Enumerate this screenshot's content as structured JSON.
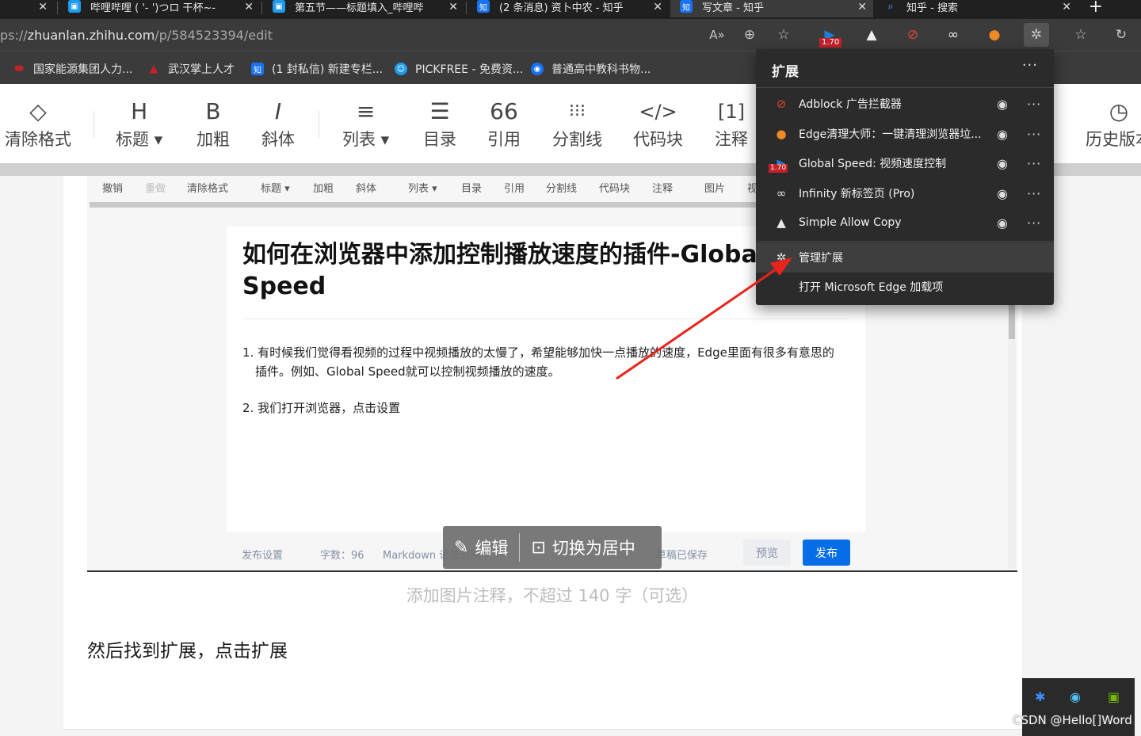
{
  "tabs": [
    {
      "title": "哔哩哔哩 ( '- ')つロ 干杯~-",
      "active": false
    },
    {
      "title": "第五节——标题填入_哔哩哔",
      "active": false
    },
    {
      "title": "(2 条消息) 资卜中农 - 知乎",
      "active": false
    },
    {
      "title": "写文章 - 知乎",
      "active": true
    },
    {
      "title": "知乎 - 搜索",
      "active": false
    }
  ],
  "address": {
    "scheme_part": "ps://",
    "host": "zhuanlan.zhihu.com",
    "path": "/p/584523394/edit",
    "speed_badge": "1.70"
  },
  "bookmarks": [
    {
      "label": "国家能源集团人力...",
      "color": "#c4222b",
      "icon_text": ""
    },
    {
      "label": "武汉掌上人才",
      "color": "#c4222b",
      "icon_text": ""
    },
    {
      "label": "(1 封私信) 新建专栏...",
      "color": "#1772f6",
      "icon_text": "知"
    },
    {
      "label": "PICKFREE - 免费资...",
      "color": "#1e9bf0",
      "icon_text": ""
    },
    {
      "label": "普通高中教科书物...",
      "color": "#1772f6",
      "icon_text": ""
    }
  ],
  "editor_toolbar": [
    {
      "icon": "◇",
      "label": "清除格式"
    },
    {
      "icon": "H",
      "label": "标题 ▾"
    },
    {
      "icon": "B",
      "label": "加粗"
    },
    {
      "icon": "I",
      "label": "斜体"
    },
    {
      "icon": "≡",
      "label": "列表 ▾"
    },
    {
      "icon": "☰",
      "label": "目录"
    },
    {
      "icon": "66",
      "label": "引用"
    },
    {
      "icon": "⁝⁝⁝",
      "label": "分割线"
    },
    {
      "icon": "</>",
      "label": "代码块"
    },
    {
      "icon": "[1]",
      "label": "注释"
    },
    {
      "icon": "◷",
      "label": "历史版本"
    }
  ],
  "mini_toolbar": [
    "撤销",
    "重做",
    "清除格式",
    "标题 ▾",
    "加粗",
    "斜体",
    "列表 ▾",
    "目录",
    "引用",
    "分割线",
    "代码块",
    "注释",
    "图片",
    "视"
  ],
  "article": {
    "title": "如何在浏览器中添加控制播放速度的插件-Global Speed",
    "p1_line1": "1. 有时候我们觉得看视频的过程中视频播放的太慢了，希望能够加快一点播放的速度，Edge里面有很多有意思的",
    "p1_line2": "插件。例如、Global Speed就可以控制视频播放的速度。",
    "p2": "2. 我们打开浏览器，点击设置"
  },
  "footer": {
    "publish_settings": "发布设置",
    "word_count": "字数：96",
    "markdown": "Markdown 语法识别中",
    "draft_saved": "草稿已保存",
    "preview": "预览",
    "publish": "发布"
  },
  "overlay": {
    "edit": "编辑",
    "center": "切换为居中"
  },
  "caption_placeholder": "添加图片注释，不超过 140 字（可选）",
  "body_text": "然后找到扩展，点击扩展",
  "extensions_popup": {
    "title": "扩展",
    "items": [
      {
        "name": "Adblock 广告拦截器",
        "icon": "⊘",
        "color": "#e0443b"
      },
      {
        "name": "Edge清理大师：一键清理浏览器垃...",
        "icon": "●",
        "color": "#f08a24"
      },
      {
        "name": "Global Speed: 视频速度控制",
        "icon": "▶",
        "color": "#1e7fd6",
        "badge": "1.70"
      },
      {
        "name": "Infinity 新标签页 (Pro)",
        "icon": "∞",
        "color": "#e8e8e8"
      },
      {
        "name": "Simple Allow Copy",
        "icon": "▲",
        "color": "#e8e8e8"
      }
    ],
    "manage": "管理扩展",
    "open_store": "打开 Microsoft Edge 加载项"
  },
  "watermark": "CSDN @Hello[]Word",
  "colors": {
    "accent": "#056de8",
    "arrow": "#e8231b",
    "popup_bg": "#2b2b2b"
  }
}
